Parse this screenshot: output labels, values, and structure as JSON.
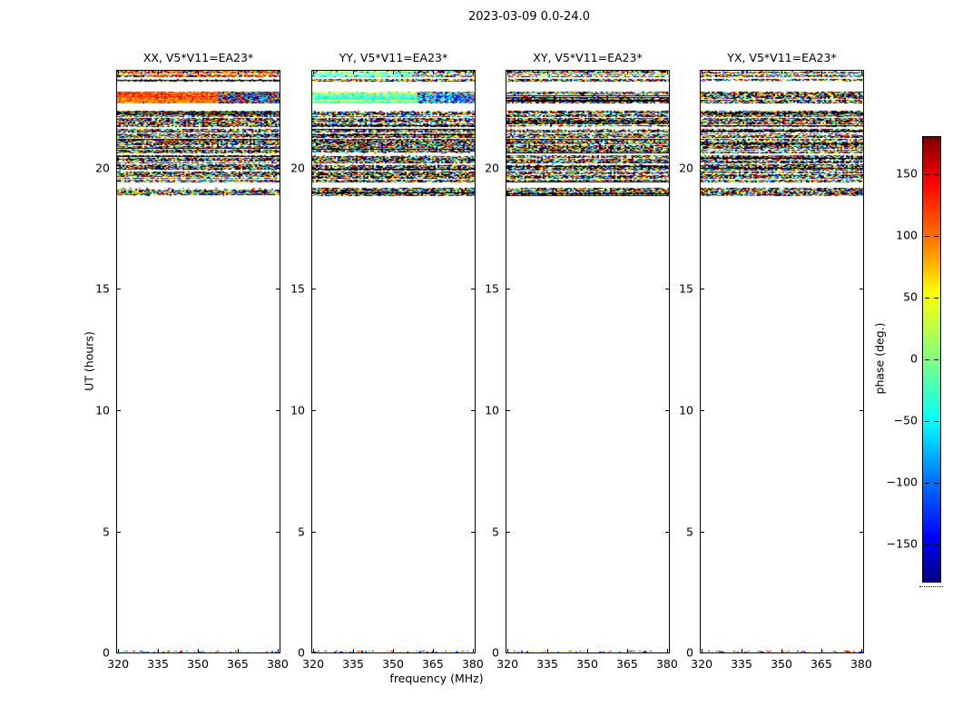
{
  "figure": {
    "suptitle": "2023-03-09 0.0-24.0",
    "xlabel": "frequency (MHz)",
    "ylabel": "UT (hours)",
    "colorbar_label": "phase (deg.)"
  },
  "chart_data": {
    "type": "heatmap",
    "description": "Dynamic-spectrum phase waterfall, 4 correlation products, frequency vs UT, phase encoded with jet colormap",
    "panels": [
      {
        "title": "XX, V5*V11=EA23*",
        "style": "warm"
      },
      {
        "title": "YY, V5*V11=EA23*",
        "style": "green"
      },
      {
        "title": "XY, V5*V11=EA23*",
        "style": "mixed"
      },
      {
        "title": "YX, V5*V11=EA23*",
        "style": "mixed"
      }
    ],
    "xlabel": "frequency (MHz)",
    "ylabel": "UT (hours)",
    "x_ticks": [
      320,
      335,
      350,
      365,
      380
    ],
    "x_tick_fractions": [
      0.006,
      0.2515,
      0.497,
      0.7425,
      0.988
    ],
    "x_range_mhz": [
      319.6,
      380.7
    ],
    "y_ticks": [
      0,
      5,
      10,
      15,
      20
    ],
    "y_range_hours": [
      0,
      24
    ],
    "time_bands": [
      {
        "from": 23.87,
        "to": 24.0,
        "kind": "special_top"
      },
      {
        "from": 23.72,
        "to": 23.84,
        "kind": "special_top"
      },
      {
        "from": 23.56,
        "to": 23.68,
        "kind": "mixed"
      },
      {
        "from": 22.66,
        "to": 23.15,
        "kind": "special"
      },
      {
        "from": 22.1,
        "to": 22.36,
        "kind": "mixed"
      },
      {
        "from": 21.67,
        "to": 22.07,
        "kind": "mixed"
      },
      {
        "from": 21.44,
        "to": 21.6,
        "kind": "mixed"
      },
      {
        "from": 21.22,
        "to": 21.41,
        "kind": "mixed"
      },
      {
        "from": 20.58,
        "to": 21.19,
        "kind": "mixed"
      },
      {
        "from": 20.17,
        "to": 20.52,
        "kind": "mixed"
      },
      {
        "from": 19.87,
        "to": 20.13,
        "kind": "mixed"
      },
      {
        "from": 19.53,
        "to": 19.84,
        "kind": "mixed"
      },
      {
        "from": 19.38,
        "to": 19.5,
        "kind": "mixed"
      },
      {
        "from": 18.82,
        "to": 19.16,
        "kind": "mixed"
      },
      {
        "from": 0.0,
        "to": 0.08,
        "kind": "sparse"
      }
    ],
    "colorbar": {
      "label": "phase (deg.)",
      "ticks": [
        150,
        100,
        50,
        0,
        -50,
        -100,
        -150
      ],
      "range": [
        -180,
        180
      ],
      "colormap": "jet",
      "orientation": "vertical",
      "position": "right"
    }
  }
}
